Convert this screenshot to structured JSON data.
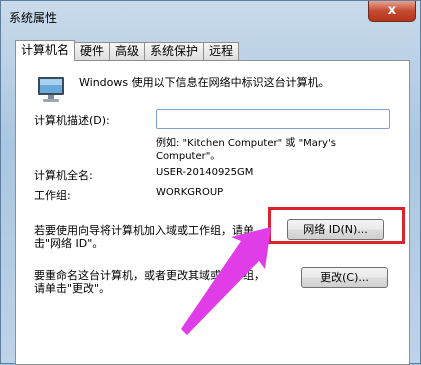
{
  "window": {
    "title": "系统属性",
    "close_label": "x"
  },
  "tabs": [
    {
      "label": "计算机名"
    },
    {
      "label": "硬件"
    },
    {
      "label": "高级"
    },
    {
      "label": "系统保护"
    },
    {
      "label": "远程"
    }
  ],
  "panel": {
    "intro": "Windows 使用以下信息在网络中标识这台计算机。",
    "description_label": "计算机描述(D):",
    "description_value": "",
    "example_line1": "例如: \"Kitchen Computer\" 或 \"Mary's",
    "example_line2": "Computer\"。",
    "full_name_label": "计算机全名:",
    "full_name_value": "USER-20140925GM",
    "workgroup_label": "工作组:",
    "workgroup_value": "WORKGROUP",
    "join_text_line1": "若要使用向导将计算机加入域或工作组，请单",
    "join_text_line2": "击\"网络 ID\"。",
    "network_id_button": "网络 ID(N)...",
    "rename_text_line1": "要重命名这台计算机，或者更改其域或工作组，",
    "rename_text_line2": "请单击\"更改\"。",
    "change_button": "更改(C)..."
  },
  "annotation": {
    "highlight_color": "#d9232d",
    "arrow_color": "#e03ce8"
  }
}
